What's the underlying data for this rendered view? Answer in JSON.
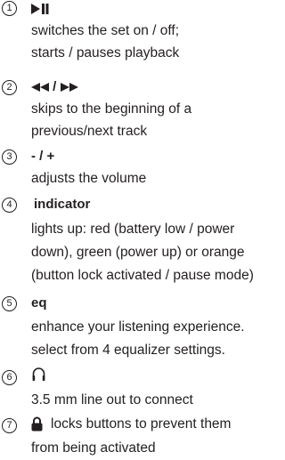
{
  "items": [
    {
      "num": "1",
      "heading": "",
      "icon": "play-pause-icon",
      "lines": [
        "switches the set on / off;",
        "starts / pauses playback"
      ]
    },
    {
      "num": "2",
      "heading": "/",
      "icon": "rewind-forward-icons",
      "lines": [
        "skips to the beginning of a",
        "previous/next track"
      ]
    },
    {
      "num": "3",
      "heading": "- / +",
      "icon": "",
      "lines": [
        "adjusts the volume"
      ]
    },
    {
      "num": "4",
      "heading": "indicator",
      "icon": "",
      "lines": [
        "lights up: red (battery low / power",
        "down), green (power up) or orange",
        "(button lock activated / pause mode)"
      ]
    },
    {
      "num": "5",
      "heading": "eq",
      "icon": "",
      "lines": [
        "enhance your listening experience.",
        "select from 4 equalizer settings."
      ]
    },
    {
      "num": "6",
      "heading": "",
      "icon": "headphones-icon",
      "lines": [
        "3.5 mm line out to connect"
      ]
    },
    {
      "num": "7",
      "heading": "",
      "icon": "lock-icon",
      "lines": [
        "locks buttons to prevent them",
        "from being activated"
      ]
    }
  ]
}
